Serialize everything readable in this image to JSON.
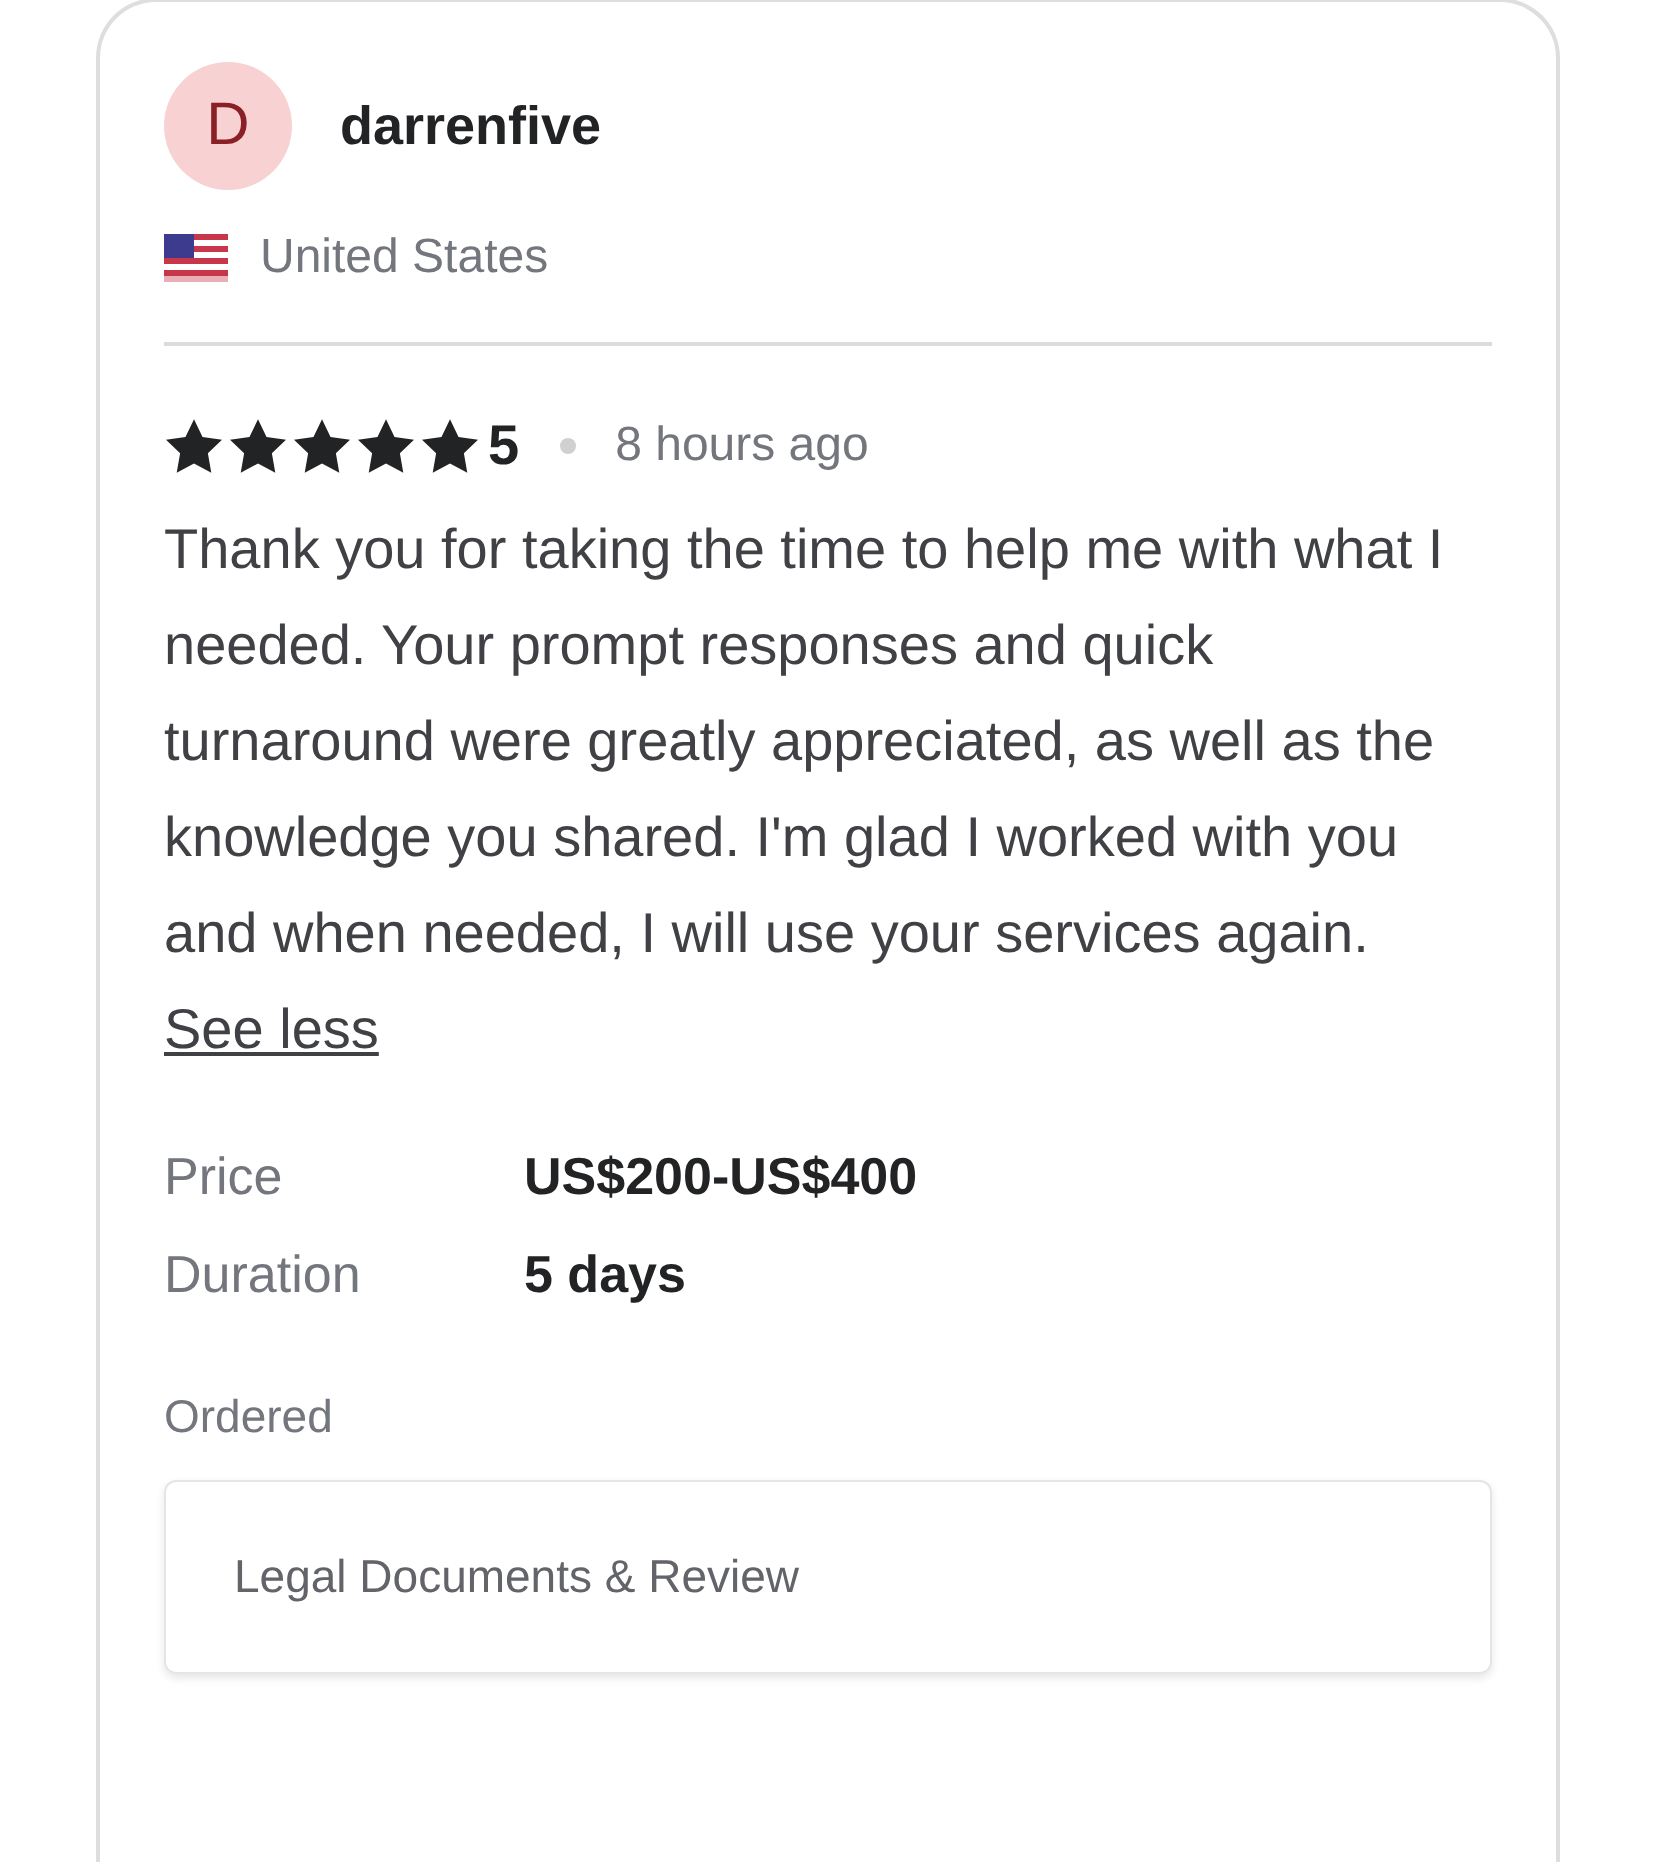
{
  "reviewer": {
    "initial": "D",
    "name": "darrenfive",
    "country": "United States"
  },
  "rating": {
    "stars": 5,
    "score": "5",
    "time": "8 hours ago"
  },
  "review": {
    "text": "Thank you for taking the time to help me with what I needed. Your prompt responses and quick turnaround were greatly appreciated, as well as the knowledge you shared. I'm glad I worked with you and when needed, I will use your services again.",
    "link": "See less"
  },
  "details": [
    {
      "label": "Price",
      "value": "US$200-US$400"
    },
    {
      "label": "Duration",
      "value": "5 days"
    }
  ],
  "ordered": {
    "label": "Ordered",
    "item": "Legal Documents & Review"
  }
}
